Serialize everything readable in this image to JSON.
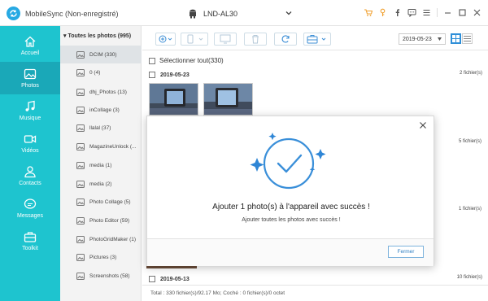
{
  "app": {
    "title": "MobileSync (Non-enregistré)",
    "device": "LND-AL30",
    "accent": "#1ec4cf",
    "title_icons": [
      "cart-icon",
      "key-icon",
      "facebook-icon",
      "chat-icon",
      "menu-icon",
      "minimize-icon",
      "maximize-icon",
      "close-icon"
    ]
  },
  "nav": {
    "items": [
      {
        "label": "Accueil",
        "icon": "home-icon"
      },
      {
        "label": "Photos",
        "icon": "photos-icon",
        "active": true
      },
      {
        "label": "Musique",
        "icon": "music-icon"
      },
      {
        "label": "Vidéos",
        "icon": "video-icon"
      },
      {
        "label": "Contacts",
        "icon": "contacts-icon"
      },
      {
        "label": "Messages",
        "icon": "messages-icon"
      },
      {
        "label": "Toolkit",
        "icon": "toolkit-icon"
      }
    ]
  },
  "folders": {
    "header": "Toutes les photos (995)",
    "items": [
      {
        "label": "DCIM (330)",
        "active": true
      },
      {
        "label": "0 (4)"
      },
      {
        "label": "dhj_Photos (13)"
      },
      {
        "label": "inCollage (3)"
      },
      {
        "label": "llalal (37)"
      },
      {
        "label": "MagazineUnlock (..."
      },
      {
        "label": "media (1)"
      },
      {
        "label": "media (2)"
      },
      {
        "label": "Photo Collage (5)"
      },
      {
        "label": "Photo Editor (59)"
      },
      {
        "label": "PhotoGridMaker (1)"
      },
      {
        "label": "Pictures (3)"
      },
      {
        "label": "Screenshots (58)"
      }
    ]
  },
  "toolbar": {
    "date_value": "2019-05-23"
  },
  "main": {
    "select_all": "Sélectionner tout(330)",
    "groups": [
      {
        "date": "2019-05-23",
        "count": "2 fichier(s)"
      },
      {
        "date": "",
        "count": "5 fichier(s)"
      },
      {
        "date": "",
        "count": "1 fichier(s)"
      },
      {
        "date": "2019-05-13",
        "count": "10 fichier(s)"
      }
    ]
  },
  "status": "Total : 330 fichier(s)/92.17 Mo; Coché : 0 fichier(s)/0 octet",
  "dialog": {
    "title": "Ajouter 1 photo(s) à l'appareil avec succès !",
    "subtitle": "Ajouter toutes les photos avec succès !",
    "button": "Fermer"
  }
}
